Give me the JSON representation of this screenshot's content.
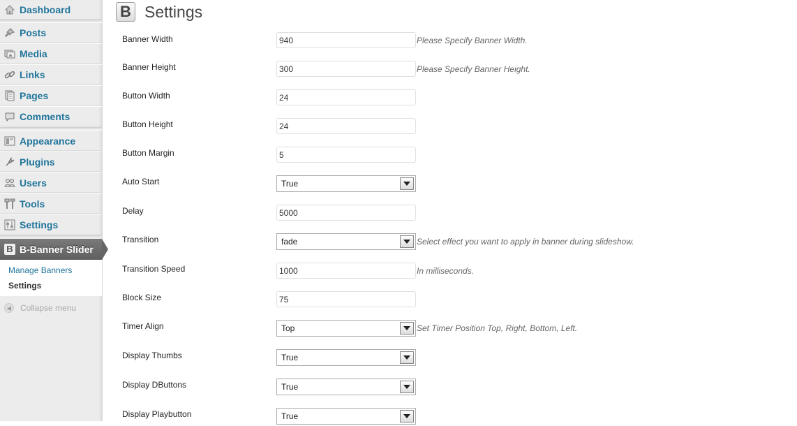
{
  "sidebar": {
    "items": [
      {
        "label": "Dashboard",
        "icon": "home-icon"
      },
      {
        "label": "Posts",
        "icon": "pin-icon"
      },
      {
        "label": "Media",
        "icon": "media-icon"
      },
      {
        "label": "Links",
        "icon": "link-icon"
      },
      {
        "label": "Pages",
        "icon": "pages-icon"
      },
      {
        "label": "Comments",
        "icon": "comment-icon"
      },
      {
        "label": "Appearance",
        "icon": "appearance-icon"
      },
      {
        "label": "Plugins",
        "icon": "plugin-icon"
      },
      {
        "label": "Users",
        "icon": "users-icon"
      },
      {
        "label": "Tools",
        "icon": "tools-icon"
      },
      {
        "label": "Settings",
        "icon": "settings-icon"
      }
    ],
    "active": {
      "label": "B-Banner Slider",
      "logo": "B"
    },
    "submenu": [
      {
        "label": "Manage Banners"
      },
      {
        "label": "Settings"
      }
    ],
    "collapse_label": "Collapse menu"
  },
  "page": {
    "logo": "B",
    "title": "Settings"
  },
  "fields": [
    {
      "label": "Banner Width",
      "type": "text",
      "value": "940",
      "hint": "Please Specify Banner Width."
    },
    {
      "label": "Banner Height",
      "type": "text",
      "value": "300",
      "hint": "Please Specify Banner Height."
    },
    {
      "label": "Button Width",
      "type": "text",
      "value": "24",
      "hint": ""
    },
    {
      "label": "Button Height",
      "type": "text",
      "value": "24",
      "hint": ""
    },
    {
      "label": "Button Margin",
      "type": "text",
      "value": "5",
      "hint": ""
    },
    {
      "label": "Auto Start",
      "type": "select",
      "value": "True",
      "hint": ""
    },
    {
      "label": "Delay",
      "type": "text",
      "value": "5000",
      "hint": ""
    },
    {
      "label": "Transition",
      "type": "select",
      "value": "fade",
      "hint": "Select effect you want to apply in banner during slideshow."
    },
    {
      "label": "Transition Speed",
      "type": "text",
      "value": "1000",
      "hint": "In milliseconds."
    },
    {
      "label": "Block Size",
      "type": "text",
      "value": "75",
      "hint": ""
    },
    {
      "label": "Timer Align",
      "type": "select",
      "value": "Top",
      "hint": "Set Timer Position Top, Right, Bottom, Left."
    },
    {
      "label": "Display Thumbs",
      "type": "select",
      "value": "True",
      "hint": ""
    },
    {
      "label": "Display DButtons",
      "type": "select",
      "value": "True",
      "hint": ""
    },
    {
      "label": "Display Playbutton",
      "type": "select",
      "value": "True",
      "hint": ""
    }
  ]
}
